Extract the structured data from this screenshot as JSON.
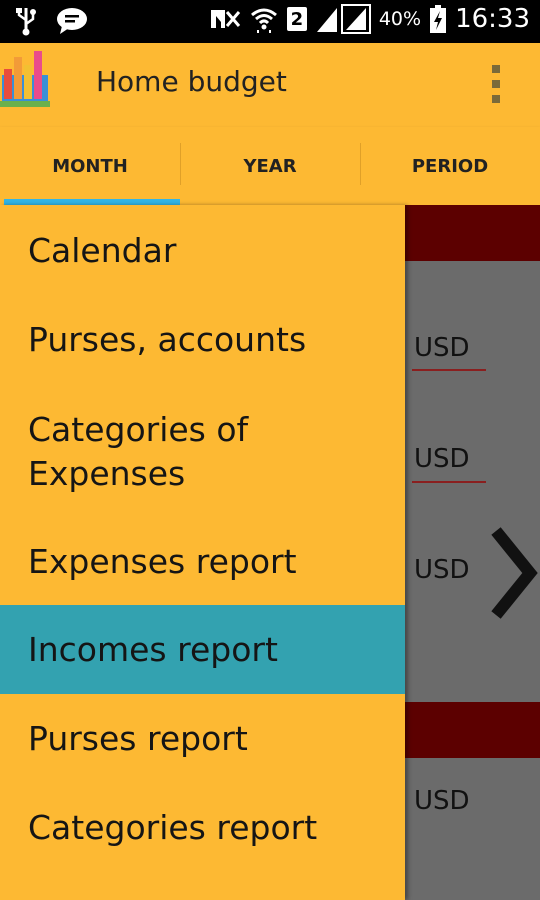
{
  "status_bar": {
    "battery": "40%",
    "time": "16:33",
    "sim_label": "2",
    "icons": [
      "usb-icon",
      "chat-icon",
      "mute-icon",
      "wifi-icon",
      "signal-icon",
      "battery-icon"
    ]
  },
  "app_bar": {
    "title": "Home budget",
    "icons": [
      "app-logo-icon",
      "overflow-menu-icon"
    ]
  },
  "tabs": [
    {
      "label": "MONTH",
      "selected": true
    },
    {
      "label": "YEAR",
      "selected": false
    },
    {
      "label": "PERIOD",
      "selected": false
    }
  ],
  "drawer": {
    "items": [
      {
        "label": "Calendar"
      },
      {
        "label": "Purses, accounts"
      },
      {
        "label": "Categories of Expenses"
      },
      {
        "label": "Expenses report"
      },
      {
        "label": "Incomes report",
        "active": true
      },
      {
        "label": "Purses report"
      },
      {
        "label": "Categories report"
      }
    ]
  },
  "background": {
    "currency_labels": [
      "USD",
      "USD",
      "USD",
      "USD"
    ],
    "icons": [
      "chevron-right-icon"
    ]
  },
  "colors": {
    "accent": "#FDB933",
    "active_item": "#33A2B0",
    "tab_indicator": "#33b5e5",
    "band": "#5c0000",
    "overlay": "#6b6b6b"
  }
}
